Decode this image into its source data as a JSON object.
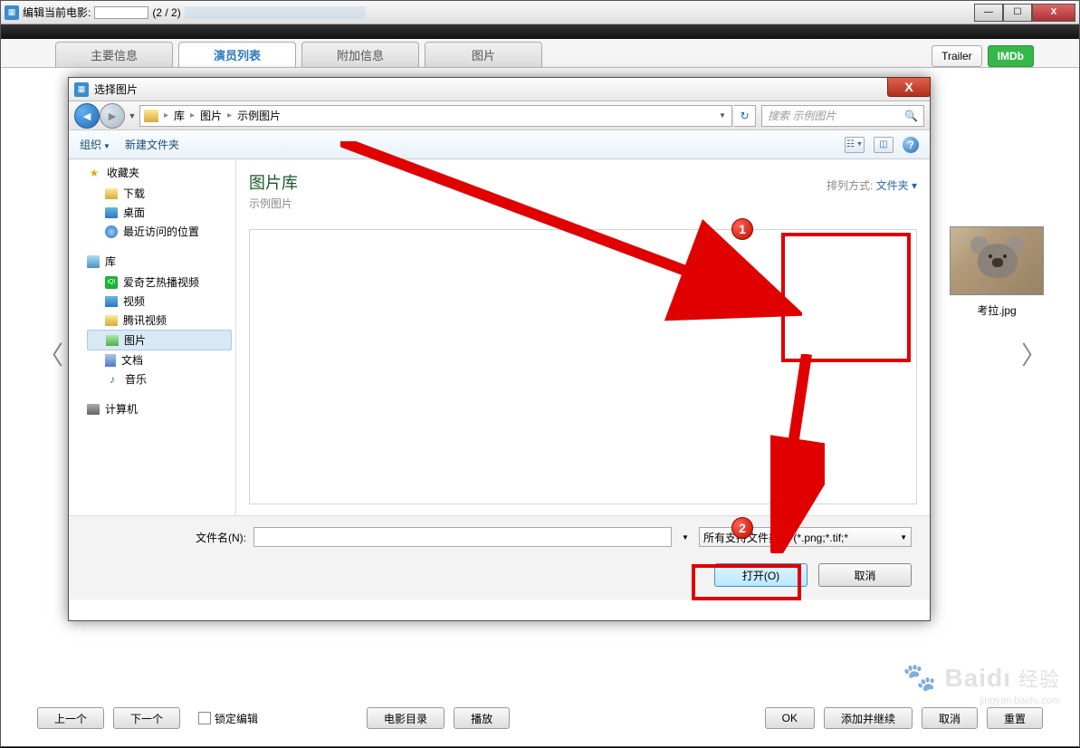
{
  "outer": {
    "title_prefix": "编辑当前电影:",
    "counter": "(2 / 2)",
    "win_min": "—",
    "win_max": "☐",
    "win_close": "X"
  },
  "tabs": {
    "main_info": "主要信息",
    "actor_list": "演员列表",
    "extra_info": "附加信息",
    "pictures": "图片"
  },
  "right_btns": {
    "trailer": "Trailer",
    "imdb": "IMDb"
  },
  "nav_caret": {
    "left": "〈",
    "right": "〉"
  },
  "bottom": {
    "prev": "上一个",
    "next": "下一个",
    "lock_edit": "锁定编辑",
    "movie_dir": "电影目录",
    "play": "播放",
    "ok": "OK",
    "add_continue": "添加并继续",
    "cancel": "取消",
    "reset": "重置"
  },
  "dialog": {
    "title": "选择图片",
    "close": "X",
    "breadcrumb": {
      "lib": "库",
      "pics": "图片",
      "sample": "示例图片"
    },
    "search_placeholder": "搜索 示例图片",
    "refresh": "↻",
    "search_icon": "🔍",
    "toolbar": {
      "organize": "组织",
      "new_folder": "新建文件夹"
    },
    "lib_title": "图片库",
    "lib_subtitle": "示例图片",
    "sort_label": "排列方式:",
    "sort_value": "文件夹",
    "file_name": "考拉.jpg",
    "filename_label": "文件名(N):",
    "filter": "所有支持文件类型 (*.png;*.tif;*",
    "open_btn": "打开(O)",
    "cancel_btn": "取消",
    "help": "?"
  },
  "sidebar": {
    "favorites": "收藏夹",
    "downloads": "下载",
    "desktop": "桌面",
    "recent": "最近访问的位置",
    "libraries": "库",
    "iqiyi": "爱奇艺热播视频",
    "video": "视频",
    "tencent": "腾讯视频",
    "pictures": "图片",
    "documents": "文档",
    "music": "音乐",
    "computer": "计算机"
  },
  "annotations": {
    "one": "1",
    "two": "2"
  },
  "watermark": {
    "brand": "Baidı",
    "exp": "经验",
    "url": "jingyan.baidu.com"
  }
}
